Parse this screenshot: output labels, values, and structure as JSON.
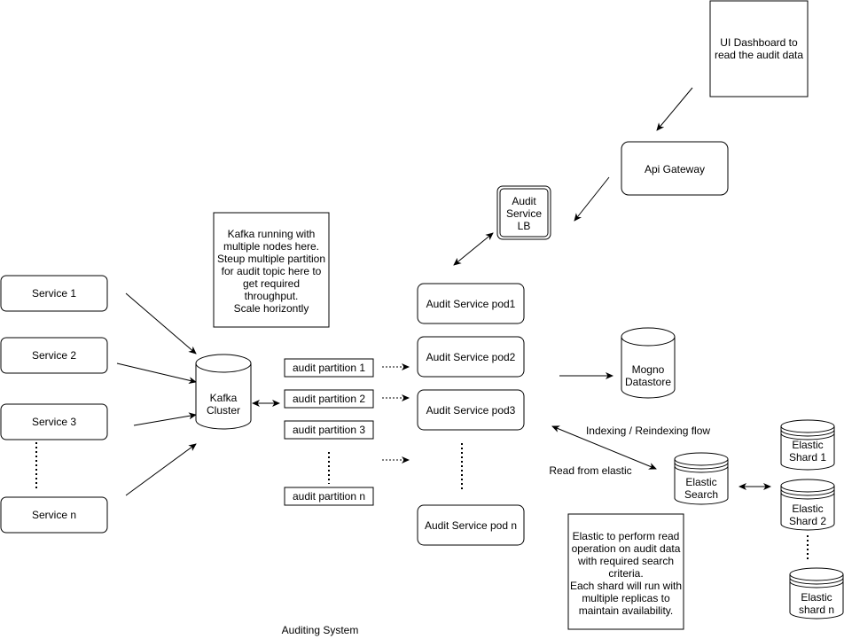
{
  "title": "Auditing System",
  "services": [
    "Service 1",
    "Service 2",
    "Service 3",
    "Service n"
  ],
  "kafka": {
    "label": [
      "Kafka",
      "Cluster"
    ]
  },
  "kafka_note": [
    "Kafka running with",
    "multiple nodes here.",
    "Steup multiple partition",
    "for audit topic here to",
    "get required",
    "throughput.",
    "Scale horizontly"
  ],
  "partitions": [
    "audit partition 1",
    "audit partition 2",
    "audit partition 3",
    "audit partition n"
  ],
  "pods": [
    "Audit Service pod1",
    "Audit Service pod2",
    "Audit Service pod3",
    "Audit Service pod n"
  ],
  "lb": [
    "Audit",
    "Service",
    "LB"
  ],
  "api_gateway": "Api Gateway",
  "dashboard": [
    "UI Dashboard to",
    "read the audit data"
  ],
  "mongo": [
    "Mogno",
    "Datastore"
  ],
  "edge_labels": {
    "indexing": "Indexing / Reindexing flow",
    "read": "Read from elastic"
  },
  "elastic": [
    "Elastic",
    "Search"
  ],
  "shards": [
    [
      "Elastic",
      "Shard 1"
    ],
    [
      "Elastic",
      "Shard 2"
    ],
    [
      "Elastic",
      "shard n"
    ]
  ],
  "elastic_note": [
    "Elastic to perform read",
    "operation on audit data",
    "with required search",
    "criteria.",
    "Each shard will run with",
    "multiple replicas to",
    "maintain availability."
  ]
}
